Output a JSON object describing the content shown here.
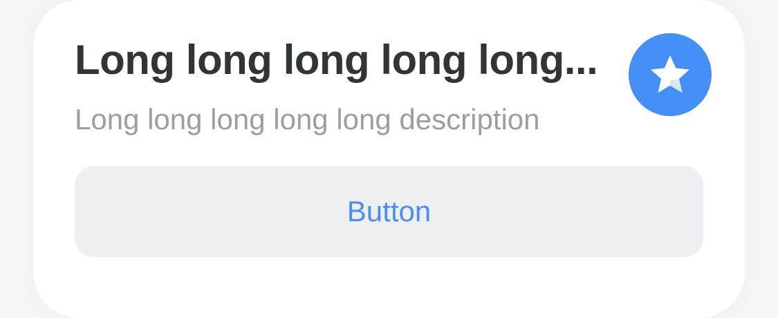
{
  "card": {
    "title": "Long long long long long...",
    "description": "Long long long long long description",
    "icon": "star-icon",
    "button_label": "Button"
  },
  "colors": {
    "accent": "#4590f6",
    "button_text": "#4a8ff0",
    "button_bg": "#efeff1",
    "title": "#333436",
    "description": "#9a9da6"
  }
}
